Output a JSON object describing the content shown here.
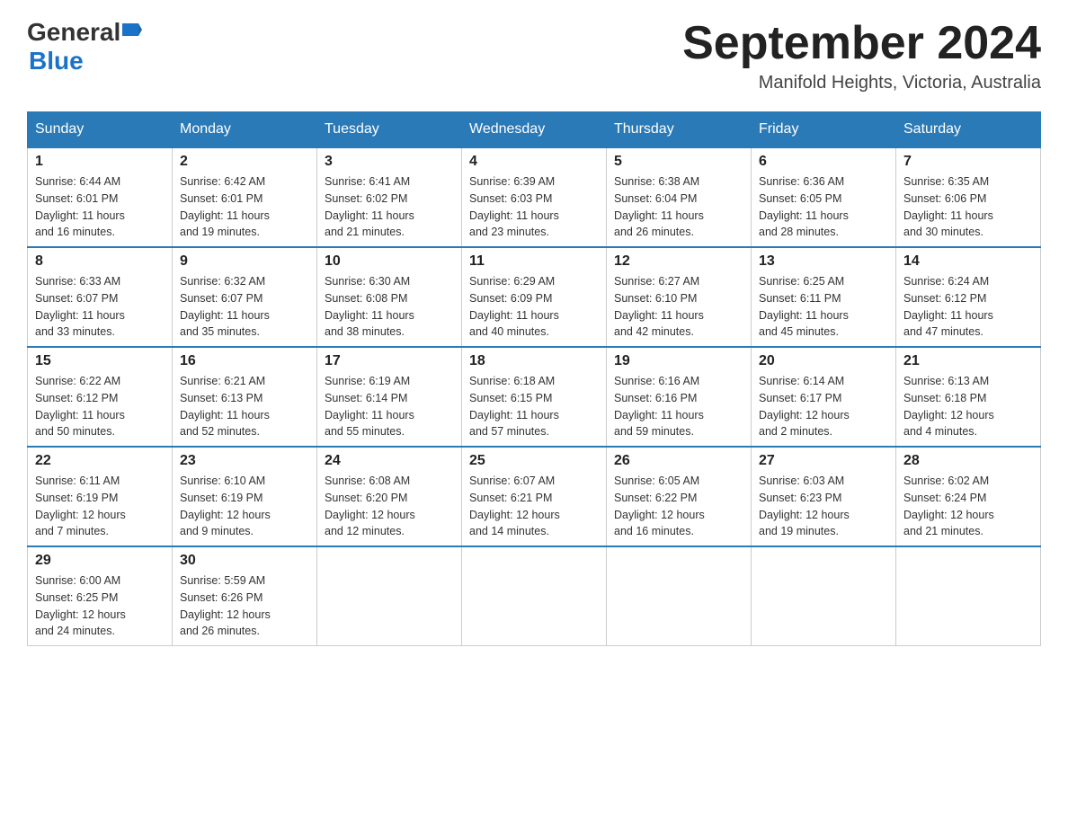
{
  "header": {
    "logo": {
      "general": "General",
      "blue": "Blue",
      "line2": "Blue"
    },
    "title": "September 2024",
    "location": "Manifold Heights, Victoria, Australia"
  },
  "calendar": {
    "days_of_week": [
      "Sunday",
      "Monday",
      "Tuesday",
      "Wednesday",
      "Thursday",
      "Friday",
      "Saturday"
    ],
    "weeks": [
      [
        {
          "day": "1",
          "sunrise": "Sunrise: 6:44 AM",
          "sunset": "Sunset: 6:01 PM",
          "daylight": "Daylight: 11 hours",
          "daylight2": "and 16 minutes."
        },
        {
          "day": "2",
          "sunrise": "Sunrise: 6:42 AM",
          "sunset": "Sunset: 6:01 PM",
          "daylight": "Daylight: 11 hours",
          "daylight2": "and 19 minutes."
        },
        {
          "day": "3",
          "sunrise": "Sunrise: 6:41 AM",
          "sunset": "Sunset: 6:02 PM",
          "daylight": "Daylight: 11 hours",
          "daylight2": "and 21 minutes."
        },
        {
          "day": "4",
          "sunrise": "Sunrise: 6:39 AM",
          "sunset": "Sunset: 6:03 PM",
          "daylight": "Daylight: 11 hours",
          "daylight2": "and 23 minutes."
        },
        {
          "day": "5",
          "sunrise": "Sunrise: 6:38 AM",
          "sunset": "Sunset: 6:04 PM",
          "daylight": "Daylight: 11 hours",
          "daylight2": "and 26 minutes."
        },
        {
          "day": "6",
          "sunrise": "Sunrise: 6:36 AM",
          "sunset": "Sunset: 6:05 PM",
          "daylight": "Daylight: 11 hours",
          "daylight2": "and 28 minutes."
        },
        {
          "day": "7",
          "sunrise": "Sunrise: 6:35 AM",
          "sunset": "Sunset: 6:06 PM",
          "daylight": "Daylight: 11 hours",
          "daylight2": "and 30 minutes."
        }
      ],
      [
        {
          "day": "8",
          "sunrise": "Sunrise: 6:33 AM",
          "sunset": "Sunset: 6:07 PM",
          "daylight": "Daylight: 11 hours",
          "daylight2": "and 33 minutes."
        },
        {
          "day": "9",
          "sunrise": "Sunrise: 6:32 AM",
          "sunset": "Sunset: 6:07 PM",
          "daylight": "Daylight: 11 hours",
          "daylight2": "and 35 minutes."
        },
        {
          "day": "10",
          "sunrise": "Sunrise: 6:30 AM",
          "sunset": "Sunset: 6:08 PM",
          "daylight": "Daylight: 11 hours",
          "daylight2": "and 38 minutes."
        },
        {
          "day": "11",
          "sunrise": "Sunrise: 6:29 AM",
          "sunset": "Sunset: 6:09 PM",
          "daylight": "Daylight: 11 hours",
          "daylight2": "and 40 minutes."
        },
        {
          "day": "12",
          "sunrise": "Sunrise: 6:27 AM",
          "sunset": "Sunset: 6:10 PM",
          "daylight": "Daylight: 11 hours",
          "daylight2": "and 42 minutes."
        },
        {
          "day": "13",
          "sunrise": "Sunrise: 6:25 AM",
          "sunset": "Sunset: 6:11 PM",
          "daylight": "Daylight: 11 hours",
          "daylight2": "and 45 minutes."
        },
        {
          "day": "14",
          "sunrise": "Sunrise: 6:24 AM",
          "sunset": "Sunset: 6:12 PM",
          "daylight": "Daylight: 11 hours",
          "daylight2": "and 47 minutes."
        }
      ],
      [
        {
          "day": "15",
          "sunrise": "Sunrise: 6:22 AM",
          "sunset": "Sunset: 6:12 PM",
          "daylight": "Daylight: 11 hours",
          "daylight2": "and 50 minutes."
        },
        {
          "day": "16",
          "sunrise": "Sunrise: 6:21 AM",
          "sunset": "Sunset: 6:13 PM",
          "daylight": "Daylight: 11 hours",
          "daylight2": "and 52 minutes."
        },
        {
          "day": "17",
          "sunrise": "Sunrise: 6:19 AM",
          "sunset": "Sunset: 6:14 PM",
          "daylight": "Daylight: 11 hours",
          "daylight2": "and 55 minutes."
        },
        {
          "day": "18",
          "sunrise": "Sunrise: 6:18 AM",
          "sunset": "Sunset: 6:15 PM",
          "daylight": "Daylight: 11 hours",
          "daylight2": "and 57 minutes."
        },
        {
          "day": "19",
          "sunrise": "Sunrise: 6:16 AM",
          "sunset": "Sunset: 6:16 PM",
          "daylight": "Daylight: 11 hours",
          "daylight2": "and 59 minutes."
        },
        {
          "day": "20",
          "sunrise": "Sunrise: 6:14 AM",
          "sunset": "Sunset: 6:17 PM",
          "daylight": "Daylight: 12 hours",
          "daylight2": "and 2 minutes."
        },
        {
          "day": "21",
          "sunrise": "Sunrise: 6:13 AM",
          "sunset": "Sunset: 6:18 PM",
          "daylight": "Daylight: 12 hours",
          "daylight2": "and 4 minutes."
        }
      ],
      [
        {
          "day": "22",
          "sunrise": "Sunrise: 6:11 AM",
          "sunset": "Sunset: 6:19 PM",
          "daylight": "Daylight: 12 hours",
          "daylight2": "and 7 minutes."
        },
        {
          "day": "23",
          "sunrise": "Sunrise: 6:10 AM",
          "sunset": "Sunset: 6:19 PM",
          "daylight": "Daylight: 12 hours",
          "daylight2": "and 9 minutes."
        },
        {
          "day": "24",
          "sunrise": "Sunrise: 6:08 AM",
          "sunset": "Sunset: 6:20 PM",
          "daylight": "Daylight: 12 hours",
          "daylight2": "and 12 minutes."
        },
        {
          "day": "25",
          "sunrise": "Sunrise: 6:07 AM",
          "sunset": "Sunset: 6:21 PM",
          "daylight": "Daylight: 12 hours",
          "daylight2": "and 14 minutes."
        },
        {
          "day": "26",
          "sunrise": "Sunrise: 6:05 AM",
          "sunset": "Sunset: 6:22 PM",
          "daylight": "Daylight: 12 hours",
          "daylight2": "and 16 minutes."
        },
        {
          "day": "27",
          "sunrise": "Sunrise: 6:03 AM",
          "sunset": "Sunset: 6:23 PM",
          "daylight": "Daylight: 12 hours",
          "daylight2": "and 19 minutes."
        },
        {
          "day": "28",
          "sunrise": "Sunrise: 6:02 AM",
          "sunset": "Sunset: 6:24 PM",
          "daylight": "Daylight: 12 hours",
          "daylight2": "and 21 minutes."
        }
      ],
      [
        {
          "day": "29",
          "sunrise": "Sunrise: 6:00 AM",
          "sunset": "Sunset: 6:25 PM",
          "daylight": "Daylight: 12 hours",
          "daylight2": "and 24 minutes."
        },
        {
          "day": "30",
          "sunrise": "Sunrise: 5:59 AM",
          "sunset": "Sunset: 6:26 PM",
          "daylight": "Daylight: 12 hours",
          "daylight2": "and 26 minutes."
        },
        {
          "day": "",
          "sunrise": "",
          "sunset": "",
          "daylight": "",
          "daylight2": ""
        },
        {
          "day": "",
          "sunrise": "",
          "sunset": "",
          "daylight": "",
          "daylight2": ""
        },
        {
          "day": "",
          "sunrise": "",
          "sunset": "",
          "daylight": "",
          "daylight2": ""
        },
        {
          "day": "",
          "sunrise": "",
          "sunset": "",
          "daylight": "",
          "daylight2": ""
        },
        {
          "day": "",
          "sunrise": "",
          "sunset": "",
          "daylight": "",
          "daylight2": ""
        }
      ]
    ]
  }
}
